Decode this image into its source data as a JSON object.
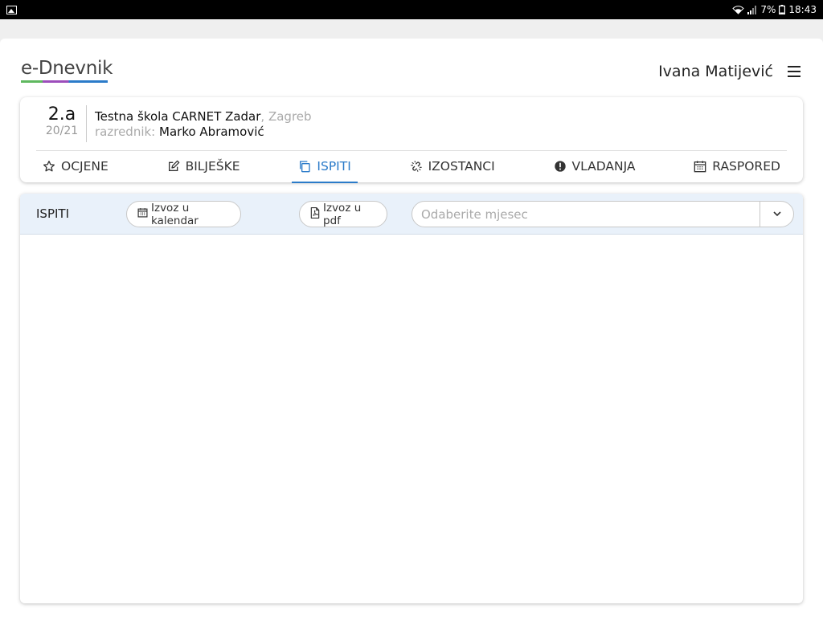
{
  "statusbar": {
    "battery": "7%",
    "time": "18:43"
  },
  "app": {
    "logo": "e-Dnevnik",
    "user_name": "Ivana Matijević"
  },
  "class_info": {
    "class_name": "2.a",
    "school_year": "20/21",
    "school_name": "Testna škola CARNET Zadar",
    "school_city": ", Zagreb",
    "teacher_label": "razrednik:",
    "teacher_name": "Marko Abramović"
  },
  "tabs": [
    {
      "label": "OCJENE",
      "icon": "star-icon",
      "active": false
    },
    {
      "label": "BILJEŠKE",
      "icon": "edit-icon",
      "active": false
    },
    {
      "label": "ISPITI",
      "icon": "copy-icon",
      "active": true
    },
    {
      "label": "IZOSTANCI",
      "icon": "broken-link-icon",
      "active": false
    },
    {
      "label": "VLADANJA",
      "icon": "exclamation-circle-icon",
      "active": false
    },
    {
      "label": "RASPORED",
      "icon": "calendar-icon",
      "active": false
    }
  ],
  "exams": {
    "title": "ISPITI",
    "export_calendar_label": "Izvoz u kalendar",
    "export_pdf_label": "Izvoz u pdf",
    "month_select_placeholder": "Odaberite mjesec"
  },
  "colors": {
    "accent": "#2b7bc9",
    "header_bg": "#e9f1fa"
  }
}
